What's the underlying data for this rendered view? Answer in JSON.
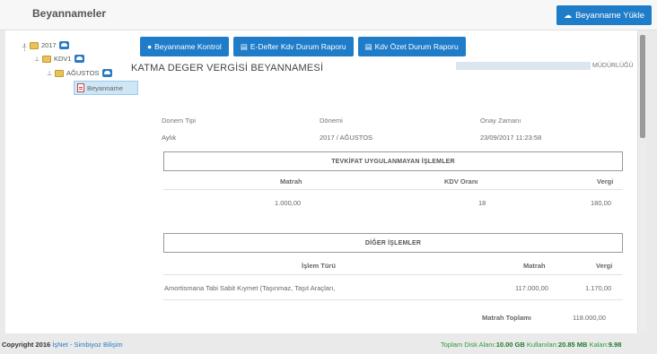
{
  "header": {
    "title": "Beyannameler",
    "upload_label": "Beyanname Yükle"
  },
  "tree": {
    "year": "2017",
    "kdv": "KDV1",
    "month": "AĞUSTOS",
    "doc": "Beyanname"
  },
  "actions": {
    "control": "Beyanname Kontrol",
    "edefter": "E-Defter Kdv Durum Raporu",
    "summary": "Kdv Özet Durum Raporu"
  },
  "declaration": {
    "title": "KATMA DEGER VERGİSİ BEYANNAMESİ",
    "office": "MÜDÜRLÜĞÜ"
  },
  "meta": {
    "period_type_label": "Donem Tipi",
    "period_type_value": "Aylık",
    "period_label": "Dönemi",
    "period_value": "2017 / AĞUSTOS",
    "approval_label": "Onay Zamanı",
    "approval_value": "23/09/2017 11:23:58"
  },
  "section1": {
    "title": "TEVKİFAT UYGULANMAYAN İŞLEMLER",
    "headers": [
      "Matrah",
      "KDV Oranı",
      "Vergi"
    ],
    "row": [
      "1.000,00",
      "18",
      "180,00"
    ]
  },
  "section2": {
    "title": "DİĞER İŞLEMLER",
    "headers": [
      "İşlem Türü",
      "Matrah",
      "Vergi"
    ],
    "row": [
      "Amortismana Tabi Sabit Kıymet (Taşınmaz, Taşıt Araçları,",
      "117.000,00",
      "1.170,00"
    ],
    "total_label": "Matrah Toplamı",
    "total_value": "118.000,00"
  },
  "footer": {
    "copyright": "Copyright 2016",
    "link": "İşNet - Simbiyoz Bilişim",
    "disk_label": "Toplam Disk Alanı:",
    "disk_total": "10.00 GB",
    "used_label": "Kullanılan:",
    "used_value": "20.85 MB",
    "left_label": "Kalan:",
    "left_value": "9.98"
  },
  "colors": {
    "primary": "#1f7cc9",
    "footer_green": "#2e9a3a"
  }
}
